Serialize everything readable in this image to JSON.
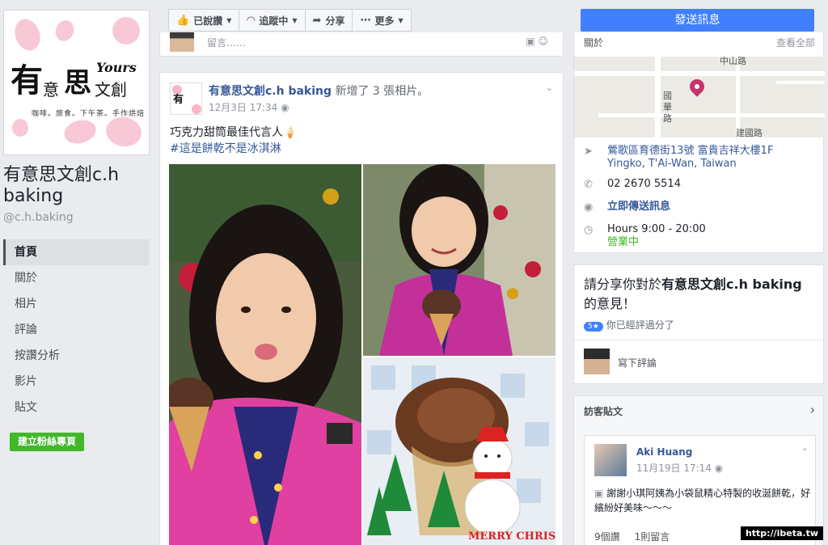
{
  "sidebar": {
    "page_name": "有意思文創c.h baking",
    "handle": "@c.h.baking",
    "logo": {
      "big": "有",
      "mid": "意",
      "big2": "思",
      "small": "文創",
      "en": "Yours",
      "tagline": "咖啡。旅食。下午茶。手作烘焙"
    },
    "nav": [
      "首頁",
      "關於",
      "相片",
      "評論",
      "按讚分析",
      "影片",
      "貼文"
    ],
    "create_button": "建立粉絲專頁"
  },
  "action_bar": {
    "liked": "已說讚",
    "following": "追蹤中",
    "share": "分享",
    "more": "更多"
  },
  "composer": {
    "placeholder": "留言……"
  },
  "post": {
    "author": "有意思文創c.h baking",
    "action": "新增了 3 張相片。",
    "timestamp": "12月3日 17:34",
    "text": "巧克力甜筒最佳代言人🍦",
    "hashtag": "#這是餅乾不是冰淇淋",
    "photo_caption": "MERRY CHRISTMAS"
  },
  "right": {
    "send_button": "發送訊息",
    "about": {
      "title": "關於",
      "see_all": "查看全部",
      "map_labels": [
        "中山路",
        "國華路",
        "建國路"
      ],
      "address_line1": "鶯歌區育德街13號 富貴吉祥大樓1F",
      "address_line2": "Yingko, T'Ai-Wan, Taiwan",
      "phone": "02 2670 5514",
      "message": "立即傳送訊息",
      "hours": "Hours 9:00 - 20:00",
      "open_status": "營業中"
    },
    "review": {
      "prompt_prefix": "請分享你對於",
      "prompt_name": "有意思文創c.h baking",
      "prompt_suffix": "的意見！",
      "badge": "5★",
      "rated": "你已經評過分了",
      "write": "寫下評論"
    },
    "visitor": {
      "title": "訪客貼文",
      "name": "Aki Huang",
      "time": "11月19日 17:14",
      "text": "謝謝小琪阿姨為小袋鼠精心特製的收涎餅乾，好繽紛好美味～～～",
      "likes": "9個讚",
      "comments": "1則留言"
    }
  },
  "watermark": "http://ibeta.tw",
  "colors": {
    "accent": "#4080ff",
    "link": "#365899",
    "green": "#42b72a",
    "bg": "#e9ebee"
  }
}
